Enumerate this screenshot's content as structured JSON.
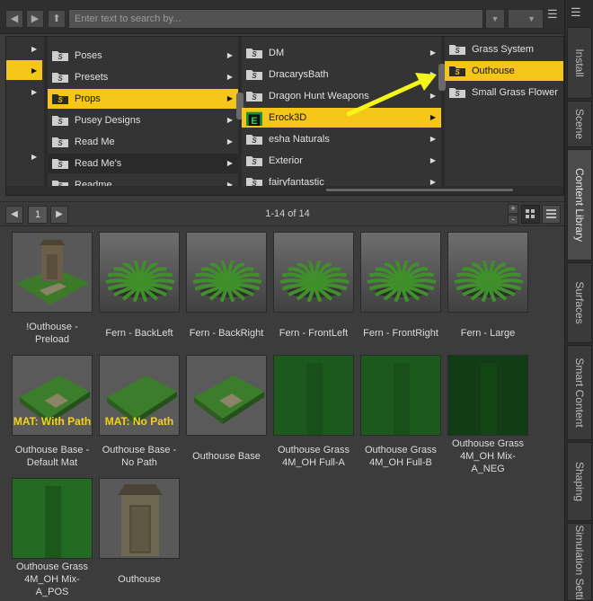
{
  "toolbar": {
    "search_placeholder": "Enter text to search by...",
    "back_icon": "◀",
    "forward_icon": "▶",
    "up_icon": "⬆",
    "dropdown_icon": "▼",
    "menu_icon": "☰"
  },
  "browser": {
    "col1": {
      "items": [
        "Poses",
        "Presets",
        "Props",
        "Pusey Designs",
        "Read Me",
        "Read Me's",
        "Readme"
      ],
      "selected": "Props"
    },
    "col2": {
      "items": [
        "DM",
        "DracarysBath",
        "Dragon Hunt Weapons",
        "Erock3D",
        "esha Naturals",
        "Exterior",
        "fairyfantastic"
      ],
      "selected": "Erock3D"
    },
    "col3": {
      "items": [
        "Grass System",
        "Outhouse",
        "Small Grass Flower"
      ],
      "selected": "Outhouse"
    }
  },
  "nav": {
    "page": "1",
    "results": "1-14 of 14",
    "zoom_plus": "+",
    "zoom_minus": "-"
  },
  "grid": {
    "items": [
      {
        "label": "!Outhouse -\nPreload",
        "kind": "outhouse-scene"
      },
      {
        "label": "Fern - BackLeft",
        "kind": "fern"
      },
      {
        "label": "Fern - BackRight",
        "kind": "fern"
      },
      {
        "label": "Fern - FrontLeft",
        "kind": "fern"
      },
      {
        "label": "Fern - FrontRight",
        "kind": "fern"
      },
      {
        "label": "Fern - Large",
        "kind": "fern"
      },
      {
        "label": "Outhouse Base -\nDefault Mat",
        "kind": "base",
        "overlay": "MAT: With Path"
      },
      {
        "label": "Outhouse Base -\nNo Path",
        "kind": "base",
        "overlay": "MAT: No Path"
      },
      {
        "label": "Outhouse Base",
        "kind": "base-plain"
      },
      {
        "label": "Outhouse Grass\n4M_OH Full-A",
        "kind": "grass"
      },
      {
        "label": "Outhouse Grass\n4M_OH Full-B",
        "kind": "grass"
      },
      {
        "label": "Outhouse Grass\n4M_OH Mix-\nA_NEG",
        "kind": "grass-dark"
      },
      {
        "label": "Outhouse Grass\n4M_OH Mix-\nA_POS",
        "kind": "grass-light"
      },
      {
        "label": "Outhouse",
        "kind": "outhouse"
      }
    ]
  },
  "sidetabs": [
    {
      "label": "Install",
      "active": false
    },
    {
      "label": "Scene",
      "active": false
    },
    {
      "label": "Content Library",
      "active": true
    },
    {
      "label": "Surfaces",
      "active": false
    },
    {
      "label": "Smart Content",
      "active": false
    },
    {
      "label": "Shaping",
      "active": false
    },
    {
      "label": "Simulation Setti",
      "active": false
    }
  ],
  "colors": {
    "selection": "#f5c518",
    "annotation_arrow": "#f5f51a"
  }
}
